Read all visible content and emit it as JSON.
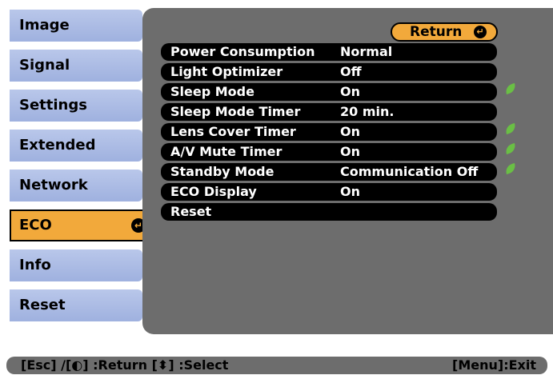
{
  "tabs": [
    {
      "label": "Image"
    },
    {
      "label": "Signal"
    },
    {
      "label": "Settings"
    },
    {
      "label": "Extended"
    },
    {
      "label": "Network"
    },
    {
      "label": "ECO"
    },
    {
      "label": "Info"
    },
    {
      "label": "Reset"
    }
  ],
  "active_tab": "ECO",
  "return_button": {
    "label": "Return"
  },
  "rows": [
    {
      "label": "Power Consumption",
      "value": "Normal",
      "eco_icon": false
    },
    {
      "label": "Light Optimizer",
      "value": "Off",
      "eco_icon": false
    },
    {
      "label": "Sleep Mode",
      "value": "On",
      "eco_icon": true
    },
    {
      "label": "Sleep Mode Timer",
      "value": " 20 min.",
      "eco_icon": false
    },
    {
      "label": "Lens Cover Timer",
      "value": "On",
      "eco_icon": true
    },
    {
      "label": "A/V Mute Timer",
      "value": "On",
      "eco_icon": true
    },
    {
      "label": "Standby Mode",
      "value": "Communication Off",
      "eco_icon": true
    },
    {
      "label": "ECO Display",
      "value": "On",
      "eco_icon": false
    },
    {
      "label": "Reset",
      "value": "",
      "eco_icon": false
    }
  ],
  "status": {
    "left": "[Esc] /[◐] :Return  [⬍] :Select",
    "right": "[Menu]:Exit"
  },
  "colors": {
    "tab": "#a9b8e4",
    "active_tab": "#f2a93b",
    "panel": "#6d6d6d",
    "row": "#000000",
    "eco_leaf": "#6abf45"
  }
}
